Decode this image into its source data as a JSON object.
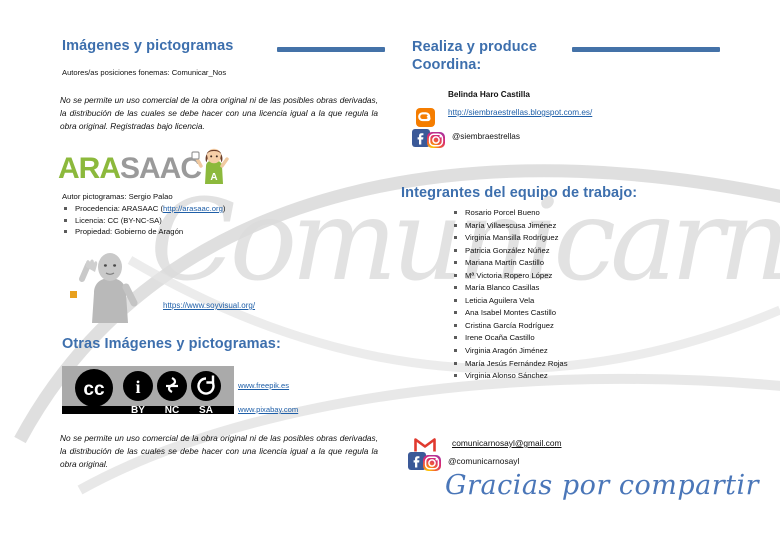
{
  "left": {
    "title": "Imágenes y pictogramas",
    "authors_line": "Autores/as posiciones fonemas: Comunicar_Nos",
    "license_text": "No se permite un uso comercial de la obra original ni de las posibles obras derivadas, la distribución de las cuales se debe hacer con una licencia igual a la que regula la obra original. Registradas bajo licencia.",
    "arasaac_logo": {
      "part_green": "ARA",
      "part_gray": "SAAC"
    },
    "credits_lead": "Autor pictogramas: Sergio Palao",
    "credits": [
      {
        "prefix": "Procedencia: ARASAAC (",
        "link": "http://arasaac.org",
        "suffix": ")"
      },
      {
        "prefix": "Licencia: CC (BY-NC-SA)",
        "link": "",
        "suffix": ""
      },
      {
        "prefix": "Propiedad: Gobierno de Aragón",
        "link": "",
        "suffix": ""
      }
    ],
    "soyvisual_link": "https://www.soyvisual.org/",
    "otras_title": "Otras Imágenes y pictogramas:",
    "cc_badge": {
      "cc": "cc",
      "by": "BY",
      "nc": "NC",
      "sa": "SA"
    },
    "freepik_link": "www.freepik.es",
    "pixabay_link": "www.pixabay.com",
    "license_text_2": "No se permite un uso comercial de la obra original ni de las posibles obras derivadas, la distribución de las cuales se debe hacer con una licencia igual a la que regula la obra original."
  },
  "right": {
    "title_line1": "Realiza y produce",
    "title_line2": "Coordina:",
    "coordinator_name": "Belinda Haro Castilla",
    "blog_url": "http://siembraestrellas.blogspot.com.es/",
    "social_handle": "@siembraestrellas",
    "team_title": "Integrantes del equipo de trabajo:",
    "team": [
      "Rosario Porcel Bueno",
      "María Villaescusa Jiménez",
      "Virginia Mansilla Rodríguez",
      "Patricia González Núñez",
      "Mariana Martín Castillo",
      "Mª Victoria Ropero López",
      "María Blanco Casillas",
      "Leticia Aguilera Vela",
      "Ana Isabel Montes Castillo",
      "Cristina García Rodríguez",
      "Irene Ocaña Castillo",
      "Virginia Aragón Jiménez",
      "María Jesús Fernández Rojas",
      "Virginia Alonso Sánchez"
    ],
    "email": "comunicarnosayl@gmail.com",
    "social_handle_2": "@comunicarnosayl",
    "thanks": "Gracias por compartir"
  },
  "background": {
    "watermark_text": "Comunicarnos"
  },
  "colors": {
    "heading_blue": "#3d6fad",
    "rule_blue": "#4472a8",
    "link_blue": "#1f5fa8",
    "arasaac_green": "#8cb93c",
    "arasaac_gray": "#9a9a9a",
    "script_blue": "#4a76b8",
    "watermark_gray": "#dedede"
  }
}
